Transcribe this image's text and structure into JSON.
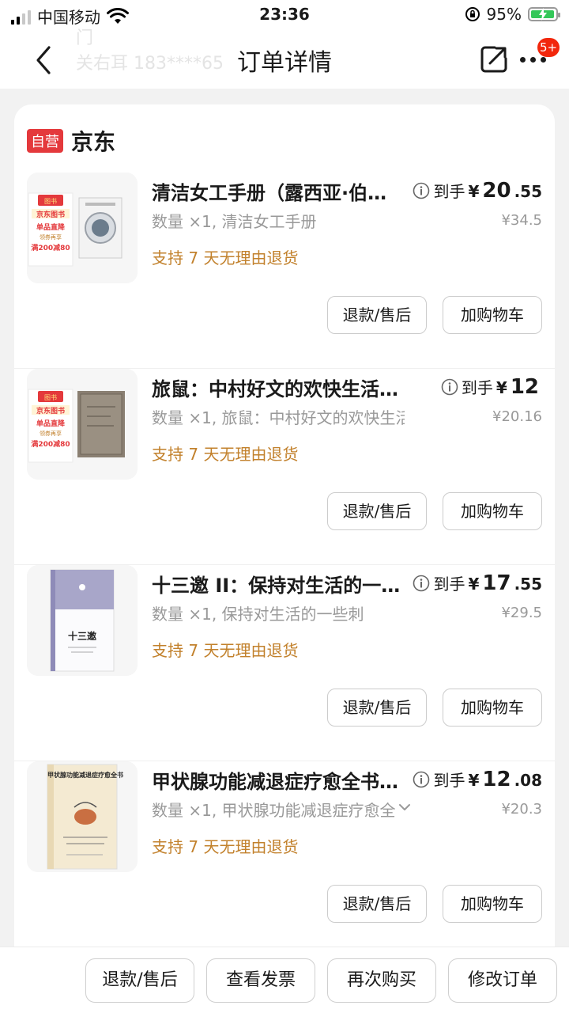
{
  "status_bar": {
    "carrier": "中国移动",
    "time": "23:36",
    "battery_percent": "95%",
    "battery_level": 0.95
  },
  "nav": {
    "title": "订单详情",
    "ghost_line1": "门",
    "ghost_line2": "关右耳  183****65",
    "more_badge": "5+"
  },
  "shop": {
    "tag": "自营",
    "name": "京东"
  },
  "price_prefix": "到手",
  "items": [
    {
      "title": "清洁女工手册（露西亚·伯…",
      "price_yen": "¥",
      "price_int": "20",
      "price_dec": ".55",
      "original_price": "¥34.5",
      "spec": "数量 ×1, 清洁女工手册",
      "return_note": "支持 7 天无理由退货",
      "refund_label": "退款/售后",
      "cart_label": "加购物车"
    },
    {
      "title": "旅鼠：中村好文的欢快生活》…",
      "price_yen": "¥",
      "price_int": "12",
      "price_dec": "",
      "original_price": "¥20.16",
      "spec": "数量 ×1, 旅鼠：中村好文的欢快生活",
      "return_note": "支持 7 天无理由退货",
      "refund_label": "退款/售后",
      "cart_label": "加购物车"
    },
    {
      "title": "十三邀 II：保持对生活的一…",
      "price_yen": "¥",
      "price_int": "17",
      "price_dec": ".55",
      "original_price": "¥29.5",
      "spec": "数量 ×1, 保持对生活的一些刺",
      "return_note": "支持 7 天无理由退货",
      "refund_label": "退款/售后",
      "cart_label": "加购物车"
    },
    {
      "title": "甲状腺功能减退症疗愈全书…",
      "price_yen": "¥",
      "price_int": "12",
      "price_dec": ".08",
      "original_price": "¥20.3",
      "spec": "数量 ×1, 甲状腺功能减退症疗愈全",
      "return_note": "支持 7 天无理由退货",
      "refund_label": "退款/售后",
      "cart_label": "加购物车"
    }
  ],
  "thumbs": {
    "promo_day": "图书",
    "promo_line1": "京东图书",
    "promo_line2": "单品直降",
    "promo_line3": "领券再享",
    "promo_line4": "满200减80",
    "book3_title": "十三邀",
    "book4_title": "甲状腺功能减退症疗愈全书",
    "book4_en": "The Women's Guide To Thyroid Health"
  },
  "bottom_bar": {
    "refund": "退款/售后",
    "invoice": "查看发票",
    "rebuy": "再次购买",
    "modify": "修改订单"
  },
  "colors": {
    "accent_red": "#e4393c",
    "return_note": "#c2812c",
    "battery_green": "#34c759"
  }
}
